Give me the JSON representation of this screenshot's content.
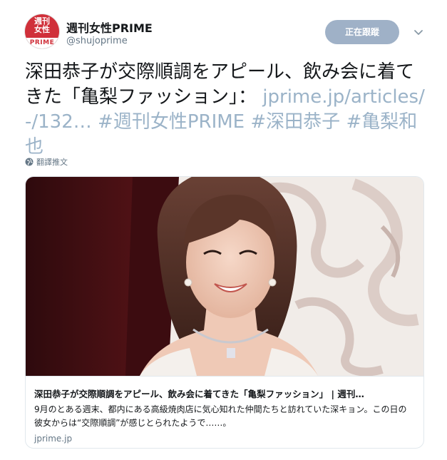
{
  "account": {
    "logo_top": "週刊\n女性",
    "logo_bottom": "PRIME",
    "display_name": "週刊女性PRIME",
    "handle": "@shujoprime"
  },
  "follow_button": {
    "label": "正在跟蹤"
  },
  "tweet": {
    "text": "深田恭子が交際順調をアピール、飲み会に着てきた「亀梨ファッション」：",
    "link": "jprime.jp/articles/-/132…",
    "hashtag_1": "#週刊女性PRIME",
    "hashtag_2": "#深田恭子",
    "hashtag_3": "#亀梨和也"
  },
  "translate": {
    "label": "翻譯推文"
  },
  "card": {
    "title": "深田恭子が交際順調をアピール、飲み会に着てきた「亀梨ファッション」 | 週刊…",
    "description": "9月のとある週末、都内にある高級焼肉店に気心知れた仲間たちと訪れていた深キョン。この日の彼女からは“交際順調”が感じとられたようで……。",
    "domain": "jprime.jp"
  },
  "icons": {
    "menu": "chevron-down-icon",
    "translate": "globe-icon"
  },
  "colors": {
    "brand_red": "#d0303a",
    "link": "#9bb3c8",
    "follow_button": "#9fb1c7",
    "muted_text": "#657786"
  }
}
